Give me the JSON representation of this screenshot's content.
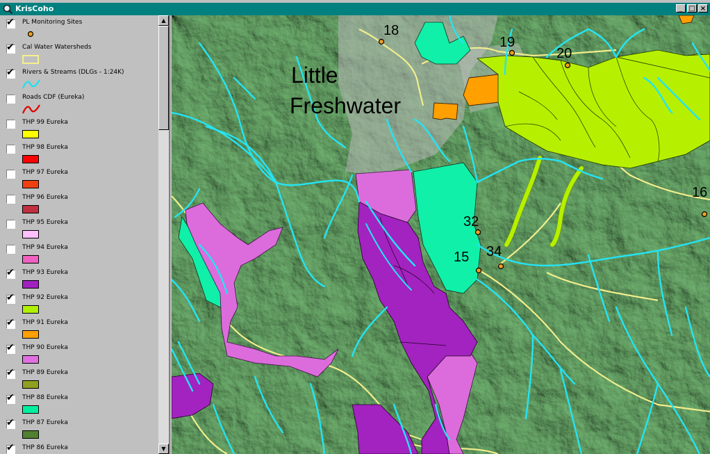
{
  "window": {
    "title": "KrisCoho",
    "buttons": {
      "minimize": "_",
      "maximize": "□",
      "close": "×"
    }
  },
  "scroll": {
    "up": "▲",
    "down": "▼"
  },
  "layers": [
    {
      "name": "PL Monitoring Sites",
      "checked": true,
      "symbol": "point",
      "color": "#f0a020"
    },
    {
      "name": "Cal Water Watersheds",
      "checked": true,
      "symbol": "outline",
      "color": "#f5f08c"
    },
    {
      "name": "Rivers & Streams (DLGs - 1:24K)",
      "checked": true,
      "symbol": "line",
      "color": "#20e0f0"
    },
    {
      "name": "Roads CDF (Eureka)",
      "checked": false,
      "symbol": "line",
      "color": "#e00000"
    },
    {
      "name": "THP 99 Eureka",
      "checked": false,
      "symbol": "fill",
      "color": "#ffff00"
    },
    {
      "name": "THP 98 Eureka",
      "checked": false,
      "symbol": "fill",
      "color": "#ff0000"
    },
    {
      "name": "THP 97 Eureka",
      "checked": false,
      "symbol": "fill",
      "color": "#f04010"
    },
    {
      "name": "THP 96 Eureka",
      "checked": false,
      "symbol": "fill",
      "color": "#c03040"
    },
    {
      "name": "THP 95 Eureka",
      "checked": false,
      "symbol": "fill",
      "color": "#ffc0ff"
    },
    {
      "name": "THP 94 Eureka",
      "checked": false,
      "symbol": "fill",
      "color": "#f060c0"
    },
    {
      "name": "THP 93 Eureka",
      "checked": true,
      "symbol": "fill",
      "color": "#a020c0"
    },
    {
      "name": "THP 92 Eureka",
      "checked": true,
      "symbol": "fill",
      "color": "#b0f000"
    },
    {
      "name": "THP 91 Eureka",
      "checked": true,
      "symbol": "fill",
      "color": "#ffa000"
    },
    {
      "name": "THP 90 Eureka",
      "checked": true,
      "symbol": "fill",
      "color": "#e070e0"
    },
    {
      "name": "THP 89 Eureka",
      "checked": true,
      "symbol": "fill",
      "color": "#90a020"
    },
    {
      "name": "THP 88 Eureka",
      "checked": true,
      "symbol": "fill",
      "color": "#00f0a0"
    },
    {
      "name": "THP 87 Eureka",
      "checked": true,
      "symbol": "fill",
      "color": "#508030"
    },
    {
      "name": "THP 86 Eureka",
      "checked": true,
      "symbol": "fill",
      "color": "#d0d0d0"
    }
  ],
  "map": {
    "place_label_line1": "Little",
    "place_label_line2": "Freshwater",
    "site_labels": [
      "18",
      "19",
      "20",
      "16",
      "32",
      "15",
      "34"
    ]
  }
}
